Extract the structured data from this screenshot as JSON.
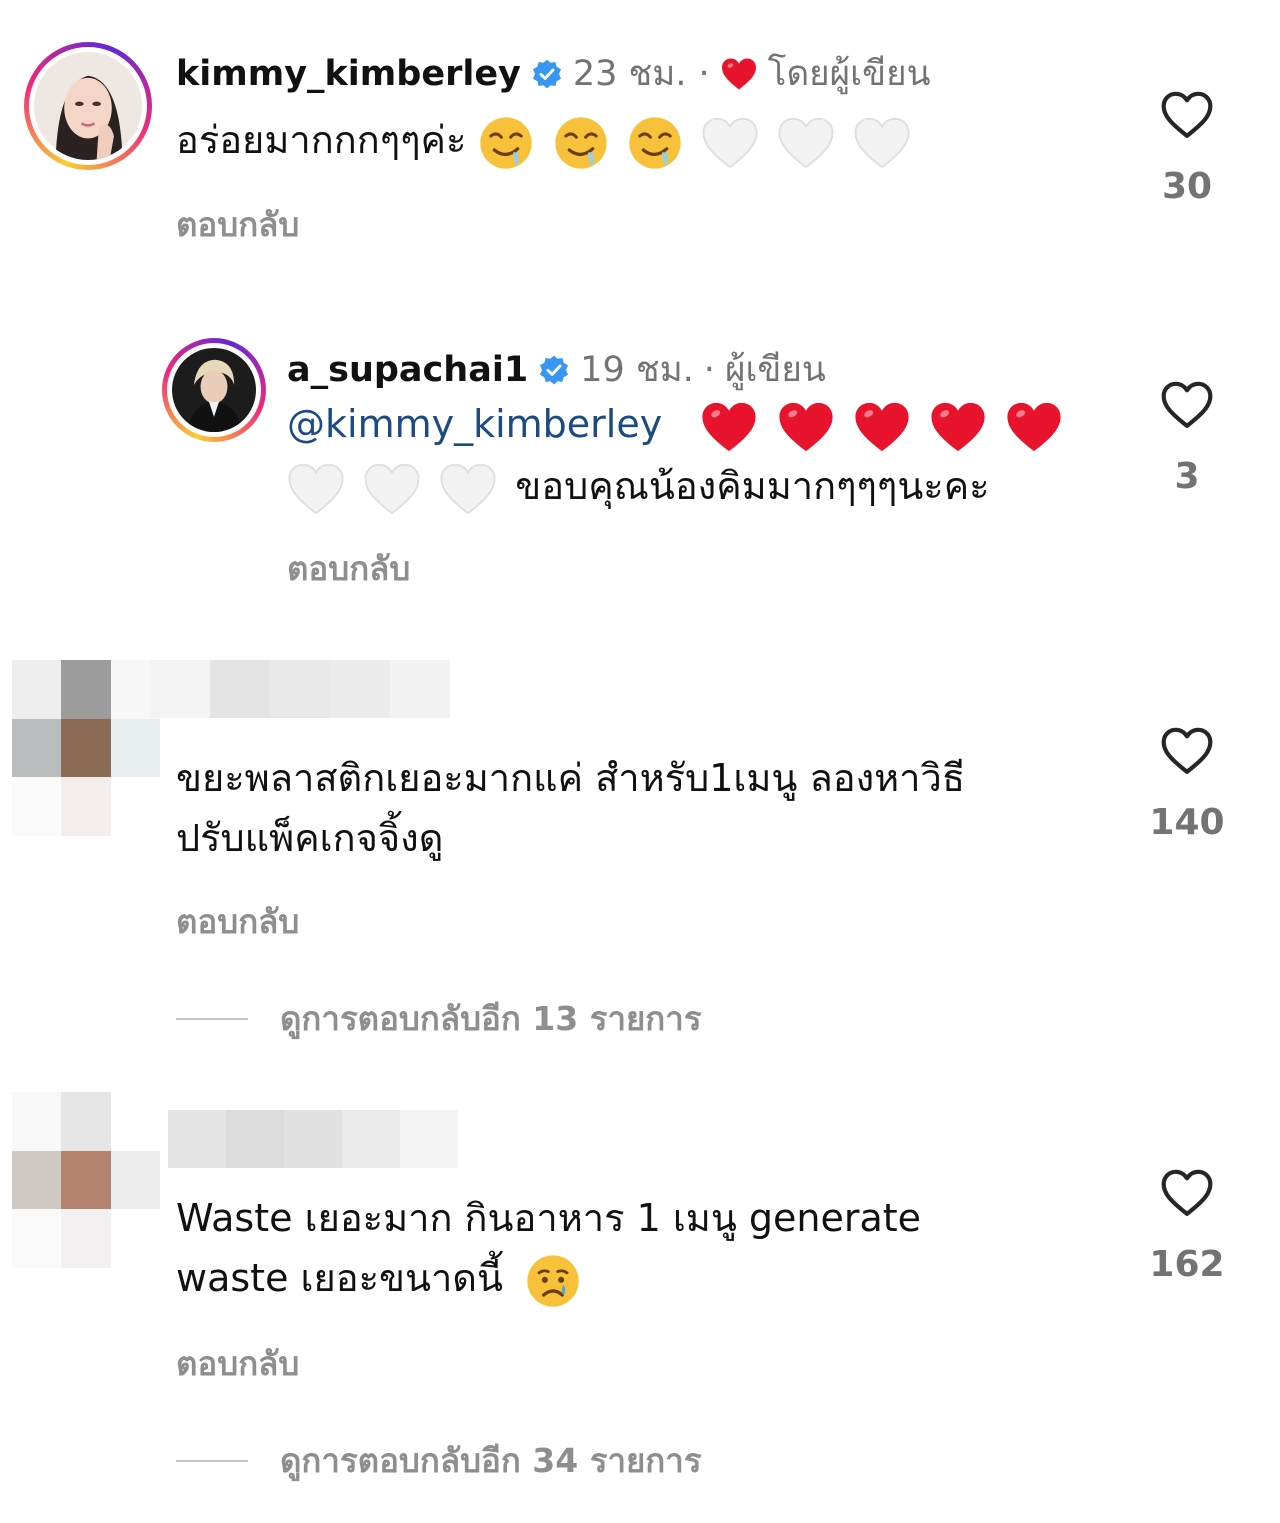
{
  "comments": [
    {
      "username": "kimmy_kimberley",
      "verified": true,
      "time": "23 ชม.",
      "separator": "·",
      "author_liked_label": "โดยผู้เขียน",
      "text": "อร่อยมากกกๆๆค่ะ",
      "reply_label": "ตอบกลับ",
      "likes": "30"
    },
    {
      "username": "a_supachai1",
      "verified": true,
      "time": "19 ชม.",
      "separator": "·",
      "author_label": "ผู้เขียน",
      "mention": "@kimmy_kimberley",
      "text": "ขอบคุณน้องคิมมากๆๆๆนะคะ",
      "reply_label": "ตอบกลับ",
      "likes": "3"
    },
    {
      "text_line1": "ขยะพลาสติกเยอะมากแค่ สำหรับ1เมนู ลองหาวิธี",
      "text_line2": "ปรับแพ็คเกจจิ้งดู",
      "reply_label": "ตอบกลับ",
      "likes": "140",
      "view_replies": "ดูการตอบกลับอีก 13 รายการ"
    },
    {
      "text_line1": "Waste เยอะมาก กินอาหาร 1 เมนู generate",
      "text_line2": "waste เยอะขนาดนี้",
      "reply_label": "ตอบกลับ",
      "likes": "162",
      "view_replies": "ดูการตอบกลับอีก 34 รายการ"
    }
  ],
  "colors": {
    "heart_red": "#e8132c",
    "verified_blue": "#3897f0",
    "meta_gray": "#737373",
    "mention_blue": "#1c4a83"
  },
  "icons": {
    "like": "heart-outline-icon",
    "verified": "verified-badge-icon",
    "emoji_drool": "drooling-face-emoji",
    "emoji_white_heart": "white-heart-emoji",
    "emoji_red_heart": "red-heart-emoji",
    "emoji_cry": "crying-face-emoji"
  }
}
